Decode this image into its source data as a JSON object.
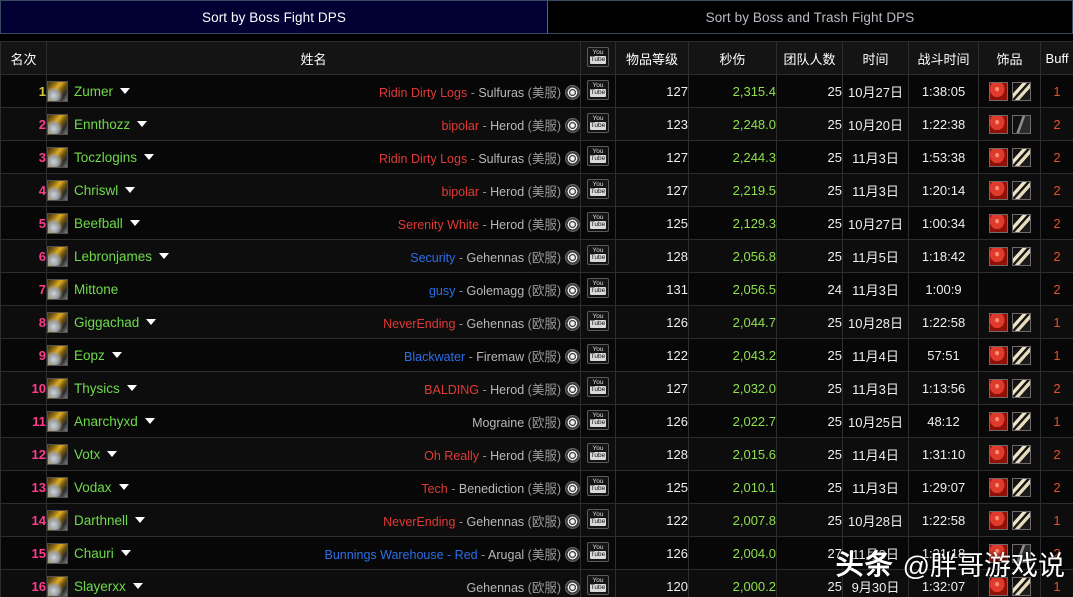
{
  "tabs": [
    {
      "label": "Sort by Boss Fight DPS",
      "active": true
    },
    {
      "label": "Sort by Boss and Trash Fight DPS",
      "active": false
    }
  ],
  "columns": {
    "rank": "名次",
    "name": "姓名",
    "video": "youtube-icon",
    "ilvl": "物品等级",
    "dps": "秒伤",
    "raid_size": "团队人数",
    "date": "时间",
    "fight_time": "战斗时间",
    "trinkets": "饰品",
    "buff": "Buff"
  },
  "colors": {
    "player_name": "#6fdb4a",
    "dps_value": "#8ee04e",
    "rank_first": "#d8c93a",
    "rank_other": "#ff3b8e",
    "buff_value": "#e2502a",
    "guild_red": "#e03a36",
    "guild_blue": "#2b6fe8",
    "active_tab_bg": "#000033"
  },
  "watermark": {
    "logo": "头条",
    "handle": "@胖哥游戏说"
  },
  "rows": [
    {
      "rank": "1",
      "name": "Zumer",
      "caret": true,
      "guild": "Ridin Dirty Logs",
      "guild_color": "#e03a36",
      "realm": "Sulfuras",
      "region": "(美服)",
      "ilvl": "127",
      "dps": "2,315.4",
      "raid": "25",
      "date": "10月27日",
      "fight": "1:38:05",
      "trinkets": [
        "red",
        "bone"
      ],
      "buff": "1"
    },
    {
      "rank": "2",
      "name": "Ennthozz",
      "caret": true,
      "guild": "bipolar",
      "guild_color": "#e03a36",
      "realm": "Herod",
      "region": "(美服)",
      "ilvl": "123",
      "dps": "2,248.0",
      "raid": "25",
      "date": "10月20日",
      "fight": "1:22:38",
      "trinkets": [
        "red",
        "dark"
      ],
      "buff": "2"
    },
    {
      "rank": "3",
      "name": "Toczlogins",
      "caret": true,
      "guild": "Ridin Dirty Logs",
      "guild_color": "#e03a36",
      "realm": "Sulfuras",
      "region": "(美服)",
      "ilvl": "127",
      "dps": "2,244.3",
      "raid": "25",
      "date": "11月3日",
      "fight": "1:53:38",
      "trinkets": [
        "red",
        "bone"
      ],
      "buff": "2"
    },
    {
      "rank": "4",
      "name": "Chriswl",
      "caret": true,
      "guild": "bipolar",
      "guild_color": "#e03a36",
      "realm": "Herod",
      "region": "(美服)",
      "ilvl": "127",
      "dps": "2,219.5",
      "raid": "25",
      "date": "11月3日",
      "fight": "1:20:14",
      "trinkets": [
        "red",
        "bone"
      ],
      "buff": "2"
    },
    {
      "rank": "5",
      "name": "Beefball",
      "caret": true,
      "guild": "Serenity White",
      "guild_color": "#e03a36",
      "realm": "Herod",
      "region": "(美服)",
      "ilvl": "125",
      "dps": "2,129.3",
      "raid": "25",
      "date": "10月27日",
      "fight": "1:00:34",
      "trinkets": [
        "red",
        "bone"
      ],
      "buff": "2"
    },
    {
      "rank": "6",
      "name": "Lebronjames",
      "caret": true,
      "guild": "Security",
      "guild_color": "#2b6fe8",
      "realm": "Gehennas",
      "region": "(欧服)",
      "ilvl": "128",
      "dps": "2,056.8",
      "raid": "25",
      "date": "11月5日",
      "fight": "1:18:42",
      "trinkets": [
        "red",
        "bone"
      ],
      "buff": "2"
    },
    {
      "rank": "7",
      "name": "Mittone",
      "caret": false,
      "guild": "gusy",
      "guild_color": "#2b6fe8",
      "realm": "Golemagg",
      "region": "(欧服)",
      "ilvl": "131",
      "dps": "2,056.5",
      "raid": "24",
      "date": "11月3日",
      "fight": "1:00:9",
      "trinkets": [],
      "buff": "2"
    },
    {
      "rank": "8",
      "name": "Giggachad",
      "caret": true,
      "guild": "NeverEnding",
      "guild_color": "#e03a36",
      "realm": "Gehennas",
      "region": "(欧服)",
      "ilvl": "126",
      "dps": "2,044.7",
      "raid": "25",
      "date": "10月28日",
      "fight": "1:22:58",
      "trinkets": [
        "red",
        "bone"
      ],
      "buff": "1"
    },
    {
      "rank": "9",
      "name": "Eopz",
      "caret": true,
      "guild": "Blackwater",
      "guild_color": "#2b6fe8",
      "realm": "Firemaw",
      "region": "(欧服)",
      "ilvl": "122",
      "dps": "2,043.2",
      "raid": "25",
      "date": "11月4日",
      "fight": "57:51",
      "trinkets": [
        "red",
        "bone"
      ],
      "buff": "1"
    },
    {
      "rank": "10",
      "name": "Thysics",
      "caret": true,
      "guild": "BALDING",
      "guild_color": "#e03a36",
      "realm": "Herod",
      "region": "(美服)",
      "ilvl": "127",
      "dps": "2,032.0",
      "raid": "25",
      "date": "11月3日",
      "fight": "1:13:56",
      "trinkets": [
        "red",
        "bone"
      ],
      "buff": "2"
    },
    {
      "rank": "11",
      "name": "Anarchyxd",
      "caret": true,
      "guild": "",
      "guild_color": "#e03a36",
      "realm": "Mograine",
      "region": "(欧服)",
      "ilvl": "126",
      "dps": "2,022.7",
      "raid": "25",
      "date": "10月25日",
      "fight": "48:12",
      "trinkets": [
        "red",
        "bone"
      ],
      "buff": "1"
    },
    {
      "rank": "12",
      "name": "Votx",
      "caret": true,
      "guild": "Oh Really",
      "guild_color": "#e03a36",
      "realm": "Herod",
      "region": "(美服)",
      "ilvl": "128",
      "dps": "2,015.6",
      "raid": "25",
      "date": "11月4日",
      "fight": "1:31:10",
      "trinkets": [
        "red",
        "bone"
      ],
      "buff": "2"
    },
    {
      "rank": "13",
      "name": "Vodax",
      "caret": true,
      "guild": "Tech",
      "guild_color": "#e03a36",
      "realm": "Benediction",
      "region": "(美服)",
      "ilvl": "125",
      "dps": "2,010.1",
      "raid": "25",
      "date": "11月3日",
      "fight": "1:29:07",
      "trinkets": [
        "red",
        "bone"
      ],
      "buff": "2"
    },
    {
      "rank": "14",
      "name": "Darthnell",
      "caret": true,
      "guild": "NeverEnding",
      "guild_color": "#e03a36",
      "realm": "Gehennas",
      "region": "(欧服)",
      "ilvl": "122",
      "dps": "2,007.8",
      "raid": "25",
      "date": "10月28日",
      "fight": "1:22:58",
      "trinkets": [
        "red",
        "bone"
      ],
      "buff": "1"
    },
    {
      "rank": "15",
      "name": "Chauri",
      "caret": true,
      "guild": "Bunnings Warehouse - Red",
      "guild_color": "#2b6fe8",
      "realm": "Arugal",
      "region": "(美服)",
      "ilvl": "126",
      "dps": "2,004.0",
      "raid": "27",
      "date": "11月3日",
      "fight": "1:21:18",
      "trinkets": [
        "red",
        "dark"
      ],
      "buff": "2"
    },
    {
      "rank": "16",
      "name": "Slayerxx",
      "caret": true,
      "guild": "",
      "guild_color": "#e03a36",
      "realm": "Gehennas",
      "region": "(欧服)",
      "ilvl": "120",
      "dps": "2,000.2",
      "raid": "25",
      "date": "9月30日",
      "fight": "1:32:07",
      "trinkets": [
        "red",
        "bone"
      ],
      "buff": "1"
    }
  ]
}
